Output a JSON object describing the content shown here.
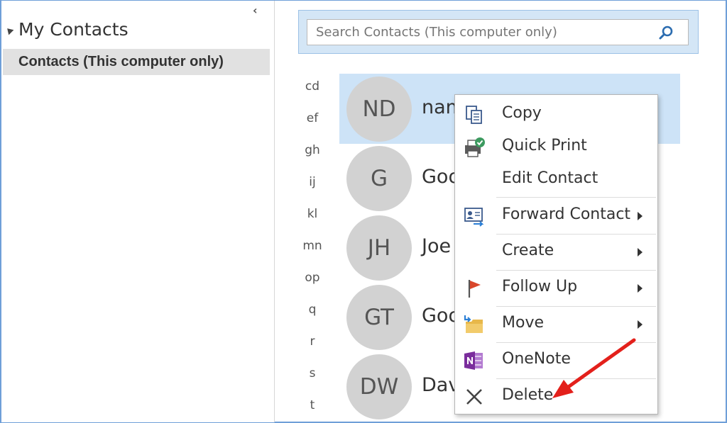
{
  "left_pane": {
    "collapse_glyph": "‹",
    "section_title": "My Contacts",
    "folder_label": "Contacts (This computer only)"
  },
  "search": {
    "placeholder": "Search Contacts (This computer only)"
  },
  "alpha_index": [
    "cd",
    "ef",
    "gh",
    "ij",
    "kl",
    "mn",
    "op",
    "q",
    "r",
    "s",
    "t"
  ],
  "contacts": [
    {
      "initials": "ND",
      "name": "nam",
      "selected": true
    },
    {
      "initials": "G",
      "name": "Goo",
      "selected": false
    },
    {
      "initials": "JH",
      "name": "Joe",
      "selected": false
    },
    {
      "initials": "GT",
      "name": "Goo",
      "selected": false
    },
    {
      "initials": "DW",
      "name": "Dav",
      "selected": false
    }
  ],
  "context_menu": {
    "items": [
      {
        "label": "Copy",
        "icon": "copy-icon",
        "submenu": false
      },
      {
        "label": "Quick Print",
        "icon": "print-icon",
        "submenu": false
      },
      {
        "label": "Edit Contact",
        "icon": "none",
        "submenu": false
      },
      {
        "label": "Forward Contact",
        "icon": "forward-contact-icon",
        "submenu": true
      },
      {
        "label": "Create",
        "icon": "none",
        "submenu": true
      },
      {
        "label": "Follow Up",
        "icon": "flag-icon",
        "submenu": true
      },
      {
        "label": "Move",
        "icon": "move-folder-icon",
        "submenu": true
      },
      {
        "label": "OneNote",
        "icon": "onenote-icon",
        "submenu": false
      },
      {
        "label": "Delete",
        "icon": "delete-x-icon",
        "submenu": false
      }
    ]
  },
  "colors": {
    "selection": "#cde3f7",
    "search_band": "#d4e6f6",
    "avatar": "#d2d2d2",
    "annotation_arrow": "#e3201b",
    "onenote_purple": "#7a2d9c",
    "flag_red": "#d9472b"
  }
}
